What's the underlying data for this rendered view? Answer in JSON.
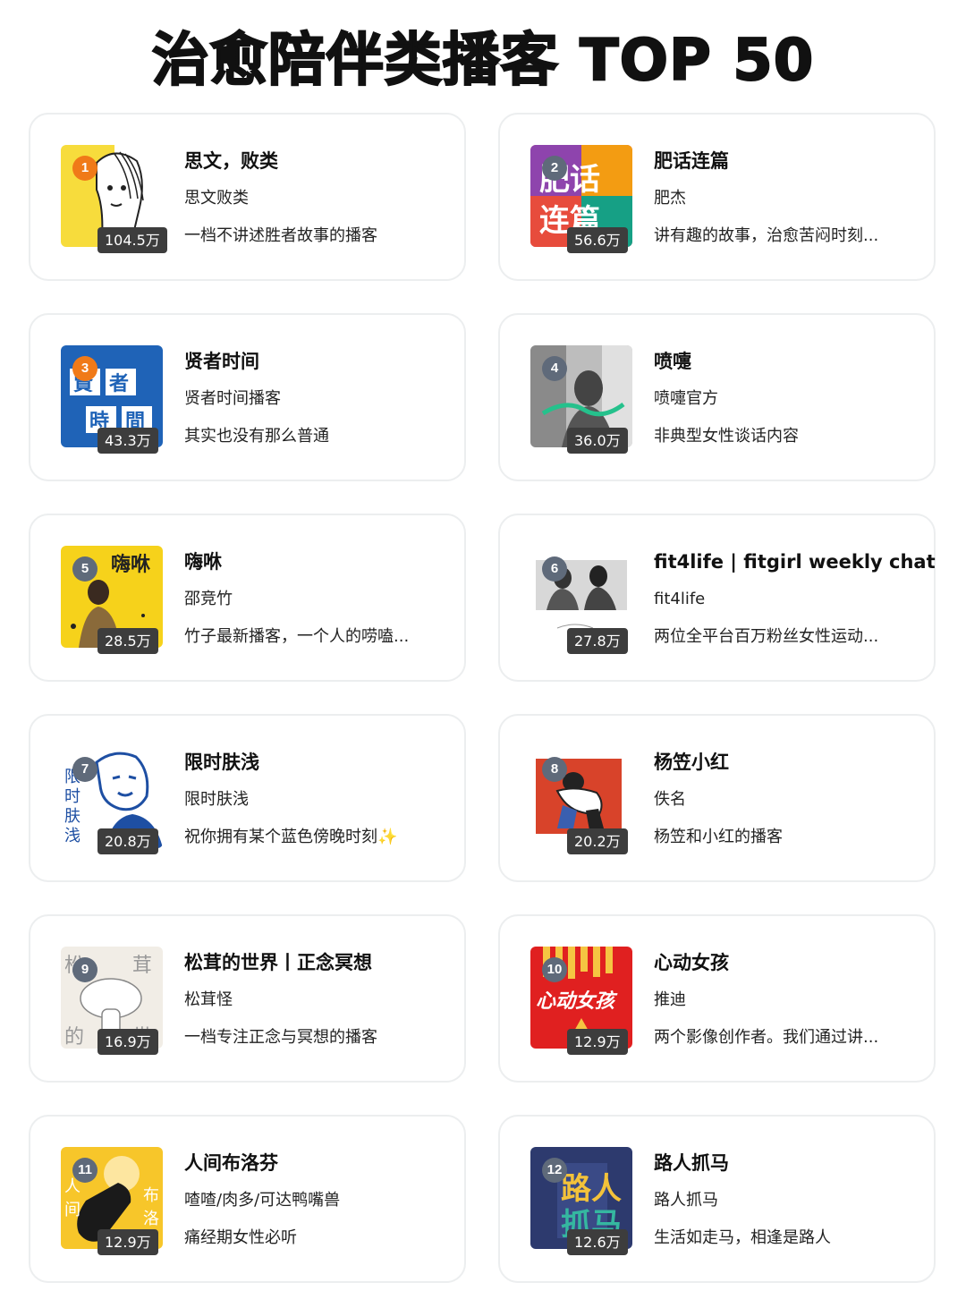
{
  "page": {
    "title": "治愈陪伴类播客 TOP 50"
  },
  "podcasts": [
    {
      "rank": "1",
      "title": "思文，败类",
      "author": "思文败类",
      "description": "一档不讲述胜者故事的播客",
      "plays": "104.5万",
      "cover": "sketch-portrait-yellow"
    },
    {
      "rank": "2",
      "title": "肥话连篇",
      "author": "肥杰",
      "description": "讲有趣的故事，治愈苦闷时刻...",
      "plays": "56.6万",
      "cover": "colorful-text-logo"
    },
    {
      "rank": "3",
      "title": "贤者时间",
      "author": "贤者时间播客",
      "description": "其实也没有那么普通",
      "plays": "43.3万",
      "cover": "blue-tiles-logo"
    },
    {
      "rank": "4",
      "title": "喷嚏",
      "author": "喷嚏官方",
      "description": "非典型女性谈话内容",
      "plays": "36.0万",
      "cover": "bw-photo-sneeze"
    },
    {
      "rank": "5",
      "title": "嗨咻",
      "author": "邵竞竹",
      "description": "竹子最新播客，一个人的唠嗑...",
      "plays": "28.5万",
      "cover": "yellow-show-photo"
    },
    {
      "rank": "6",
      "title": "fit4life | fitgirl weekly chat",
      "author": "fit4life",
      "description": "两位全平台百万粉丝女性运动...",
      "plays": "27.8万",
      "cover": "two-women-photo"
    },
    {
      "rank": "7",
      "title": "限时肤浅",
      "author": "限时肤浅",
      "description": "祝你拥有某个蓝色傍晚时刻✨",
      "plays": "20.8万",
      "cover": "blue-line-portrait"
    },
    {
      "rank": "8",
      "title": "杨笠小红",
      "author": "佚名",
      "description": "杨笠和小红的播客",
      "plays": "20.2万",
      "cover": "red-hug-illustration"
    },
    {
      "rank": "9",
      "title": "松茸的世界丨正念冥想",
      "author": "松茸怪",
      "description": "一档专注正念与冥想的播客",
      "plays": "16.9万",
      "cover": "mushroom-world"
    },
    {
      "rank": "10",
      "title": "心动女孩",
      "author": "推迪",
      "description": "两个影像创作者。我们通过讲...",
      "plays": "12.9万",
      "cover": "red-fries-logo"
    },
    {
      "rank": "11",
      "title": "人间布洛芬",
      "author": "喳喳/肉多/可达鸭嘴兽",
      "description": "痛经期女性必听",
      "plays": "12.9万",
      "cover": "yellow-capsule"
    },
    {
      "rank": "12",
      "title": "路人抓马",
      "author": "路人抓马",
      "description": "生活如走马，相逢是路人",
      "plays": "12.6万",
      "cover": "navy-lettering"
    }
  ],
  "colors": {
    "rank_top": "#f07a18",
    "rank_other": "#5f6a7a",
    "badge_bg": "#3d3d3d"
  }
}
